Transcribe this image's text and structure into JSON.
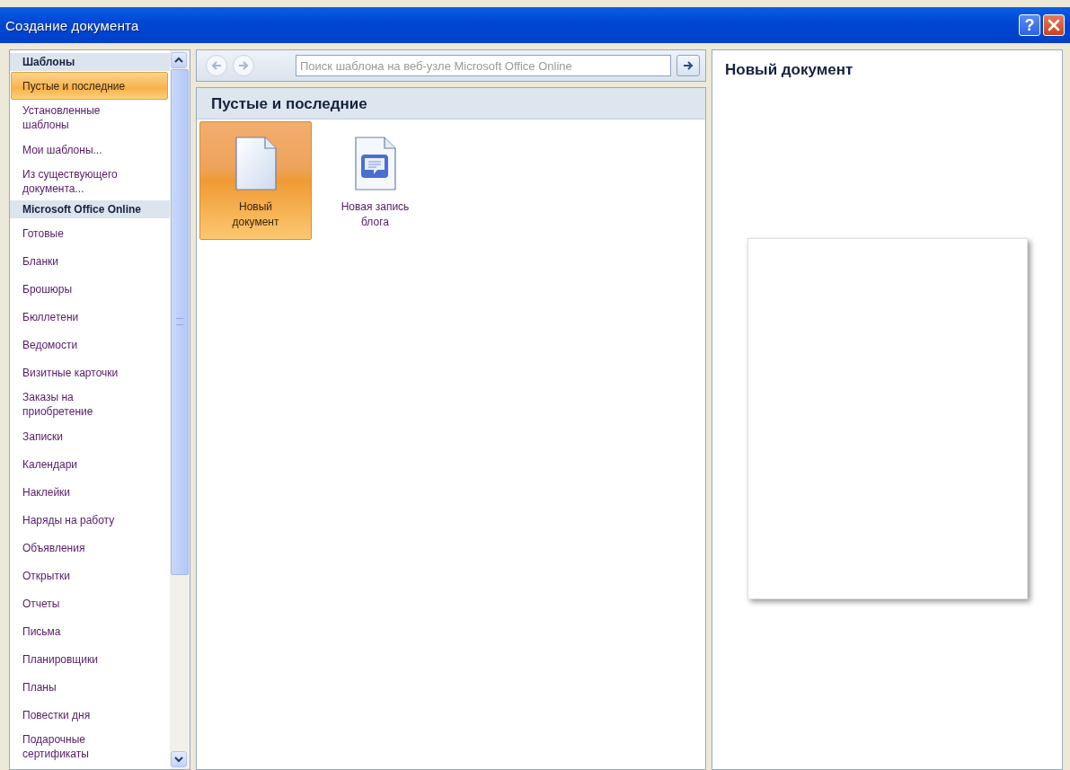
{
  "window": {
    "title": "Создание документа",
    "help_label": "?"
  },
  "sidebar": {
    "items": [
      {
        "kind": "header",
        "label": "Шаблоны"
      },
      {
        "kind": "item",
        "label": "Пустые и последние",
        "selected": true
      },
      {
        "kind": "item",
        "label": "Установленные шаблоны",
        "selected": false
      },
      {
        "kind": "item",
        "label": "Мои шаблоны...",
        "selected": false
      },
      {
        "kind": "item",
        "label": "Из существующего документа...",
        "selected": false
      },
      {
        "kind": "header",
        "label": "Microsoft Office Online"
      },
      {
        "kind": "item",
        "label": "Готовые",
        "selected": false
      },
      {
        "kind": "item",
        "label": "Бланки",
        "selected": false
      },
      {
        "kind": "item",
        "label": "Брошюры",
        "selected": false
      },
      {
        "kind": "item",
        "label": "Бюллетени",
        "selected": false
      },
      {
        "kind": "item",
        "label": "Ведомости",
        "selected": false
      },
      {
        "kind": "item",
        "label": "Визитные карточки",
        "selected": false
      },
      {
        "kind": "item",
        "label": "Заказы на приобретение",
        "selected": false
      },
      {
        "kind": "item",
        "label": "Записки",
        "selected": false
      },
      {
        "kind": "item",
        "label": "Календари",
        "selected": false
      },
      {
        "kind": "item",
        "label": "Наклейки",
        "selected": false
      },
      {
        "kind": "item",
        "label": "Наряды на работу",
        "selected": false
      },
      {
        "kind": "item",
        "label": "Объявления",
        "selected": false
      },
      {
        "kind": "item",
        "label": "Открытки",
        "selected": false
      },
      {
        "kind": "item",
        "label": "Отчеты",
        "selected": false
      },
      {
        "kind": "item",
        "label": "Письма",
        "selected": false
      },
      {
        "kind": "item",
        "label": "Планировщики",
        "selected": false
      },
      {
        "kind": "item",
        "label": "Планы",
        "selected": false
      },
      {
        "kind": "item",
        "label": "Повестки дня",
        "selected": false
      },
      {
        "kind": "item",
        "label": "Подарочные сертификаты",
        "selected": false
      }
    ]
  },
  "search": {
    "placeholder": "Поиск шаблона на веб-узле Microsoft Office Online"
  },
  "section": {
    "title": "Пустые и последние",
    "templates": [
      {
        "kind": "blank",
        "label": "Новый документ",
        "selected": true
      },
      {
        "kind": "blog",
        "label": "Новая запись блога",
        "selected": false
      }
    ]
  },
  "preview": {
    "title": "Новый документ"
  }
}
